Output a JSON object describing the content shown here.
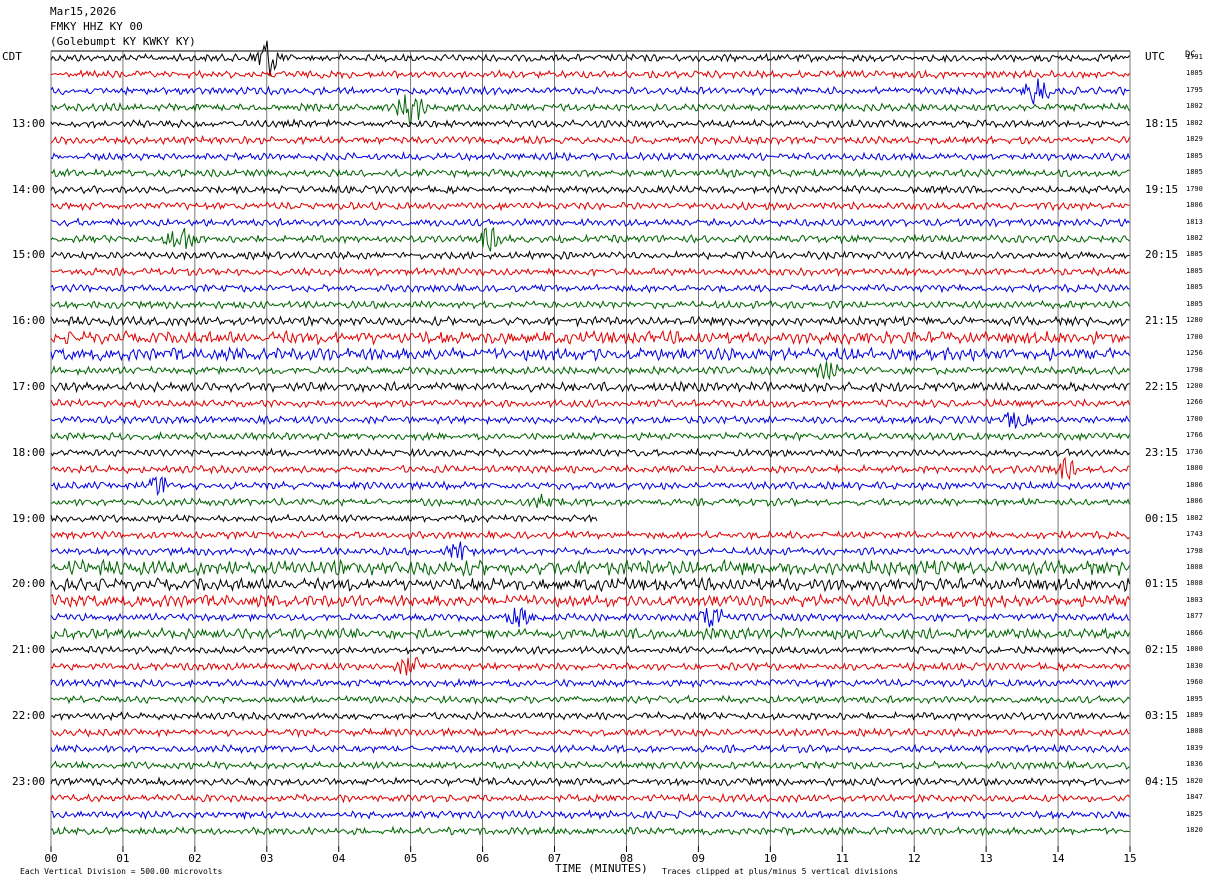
{
  "header": {
    "date": "Mar15,2026",
    "station": "FMKY HHZ KY 00",
    "site": "(Golebumpt KY KWKY KY)"
  },
  "left_tz": "CDT",
  "right_tz": "UTC",
  "dc_label": "DC",
  "x_title": "TIME (MINUTES)",
  "footer": {
    "scale_note": "Each Vertical Division =  500.00 microvolts",
    "clip_note": "Traces clipped at plus/minus 5 vertical divisions"
  },
  "chart_data": {
    "type": "line",
    "title": "",
    "xlabel": "TIME (MINUTES)",
    "xlim": [
      0,
      15
    ],
    "x_ticks": [
      "00",
      "01",
      "02",
      "03",
      "04",
      "05",
      "06",
      "07",
      "08",
      "09",
      "10",
      "11",
      "12",
      "13",
      "14",
      "15"
    ],
    "left_hour_labels": [
      "13:00",
      "14:00",
      "15:00",
      "16:00",
      "17:00",
      "18:00",
      "19:00",
      "20:00",
      "21:00",
      "22:00",
      "23:00"
    ],
    "right_hour_labels": [
      "18:15",
      "19:15",
      "20:15",
      "21:15",
      "22:15",
      "23:15",
      "00:15",
      "01:15",
      "02:15",
      "03:15",
      "04:15"
    ],
    "trace_colors": [
      "#000000",
      "#e00000",
      "#0000e0",
      "#006400"
    ],
    "trace_count": 48,
    "dc_offsets": [
      "1791",
      "1805",
      "1795",
      "1802",
      "1802",
      "1829",
      "1805",
      "1805",
      "1790",
      "1806",
      "1813",
      "1802",
      "1805",
      "1805",
      "1805",
      "1805",
      "1280",
      "1700",
      "1256",
      "1798",
      "1200",
      "1266",
      "1700",
      "1766",
      "1736",
      "1800",
      "1806",
      "1806",
      "1802",
      "1743",
      "1798",
      "1808",
      "1808",
      "1803",
      "1877",
      "1866",
      "1800",
      "1830",
      "1960",
      "1895",
      "1889",
      "1808",
      "1839",
      "1836",
      "1820",
      "1847",
      "1825",
      "1820"
    ],
    "gap_row": 28,
    "gap_range": [
      7.6,
      15
    ],
    "amplitude_note": "Traces clipped at plus/minus 5 vertical divisions"
  }
}
